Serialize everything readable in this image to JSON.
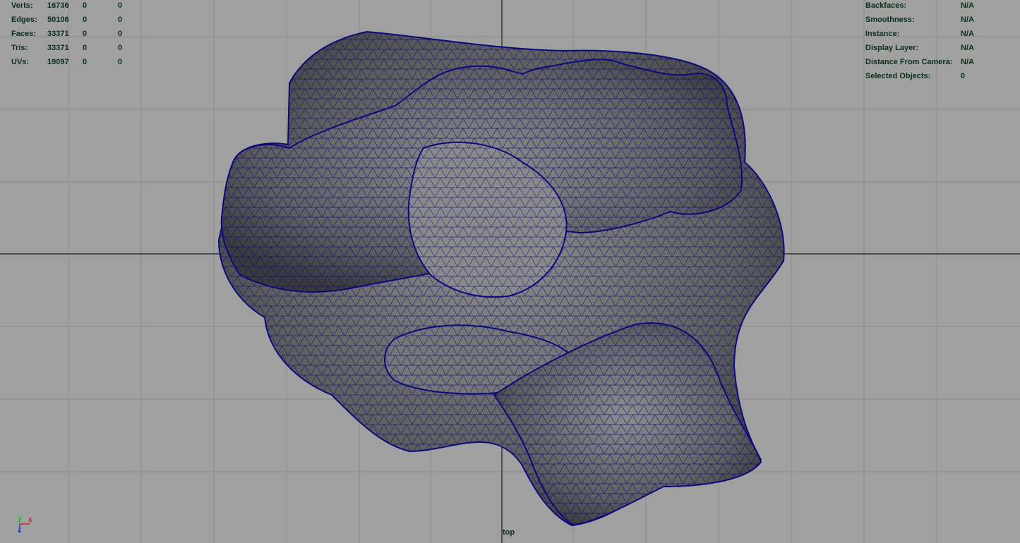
{
  "viewport": {
    "camera_name": "top",
    "background_color": "#a0a0a0",
    "grid_color": "#8a8a8a",
    "axis_line_color": "#1a1a1a",
    "wireframe_color": "#0a0a7a",
    "mesh_fill_color": "#6b6b6b"
  },
  "poly_count": [
    {
      "label": "Verts:",
      "col1": "16736",
      "col2": "0",
      "col3": "0"
    },
    {
      "label": "Edges:",
      "col1": "50106",
      "col2": "0",
      "col3": "0"
    },
    {
      "label": "Faces:",
      "col1": "33371",
      "col2": "0",
      "col3": "0"
    },
    {
      "label": "Tris:",
      "col1": "33371",
      "col2": "0",
      "col3": "0"
    },
    {
      "label": "UVs:",
      "col1": "19097",
      "col2": "0",
      "col3": "0"
    }
  ],
  "object_details": [
    {
      "label": "Backfaces:",
      "value": "N/A"
    },
    {
      "label": "Smoothness:",
      "value": "N/A"
    },
    {
      "label": "Instance:",
      "value": "N/A"
    },
    {
      "label": "Display Layer:",
      "value": "N/A"
    },
    {
      "label": "Distance From Camera:",
      "value": "N/A"
    },
    {
      "label": "Selected Objects:",
      "value": "0"
    }
  ],
  "axis_gizmo": {
    "x_label": "x",
    "y_label": "y",
    "z_label": "z",
    "x_color": "#e02020",
    "y_color": "#20c040",
    "z_color": "#2040e0"
  }
}
